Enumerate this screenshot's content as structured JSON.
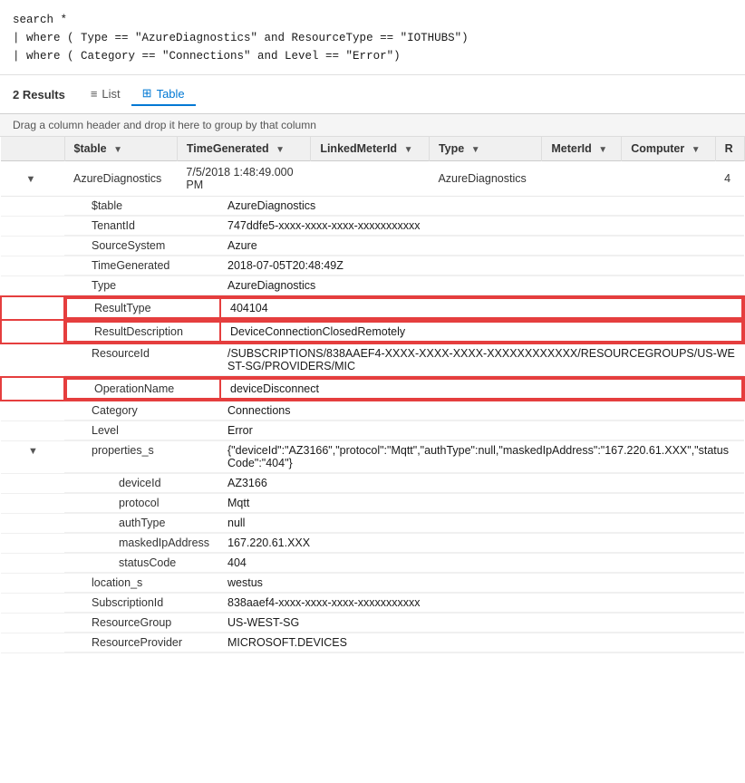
{
  "query": {
    "lines": [
      "search *",
      "| where ( Type == \"AzureDiagnostics\" and ResourceType == \"IOTHUBS\")",
      "| where ( Category == \"Connections\" and Level == \"Error\")"
    ]
  },
  "results": {
    "count": "2",
    "count_label": "Results",
    "tabs": [
      {
        "id": "list",
        "label": "List",
        "icon": "≡",
        "active": false
      },
      {
        "id": "table",
        "label": "Table",
        "icon": "⊞",
        "active": true
      }
    ],
    "drag_hint": "Drag a column header and drop it here to group by that column",
    "columns": [
      {
        "id": "stable",
        "label": "$table"
      },
      {
        "id": "timegenerated",
        "label": "TimeGenerated"
      },
      {
        "id": "linkedmeterid",
        "label": "LinkedMeterId"
      },
      {
        "id": "type",
        "label": "Type"
      },
      {
        "id": "meterid",
        "label": "MeterId"
      },
      {
        "id": "computer",
        "label": "Computer"
      },
      {
        "id": "r",
        "label": "R"
      }
    ],
    "rows": [
      {
        "id": "row1",
        "expand": true,
        "stable": "AzureDiagnostics",
        "timegenerated": "7/5/2018 1:48:49.000 PM",
        "linkedmeterid": "",
        "type": "AzureDiagnostics",
        "meterid": "",
        "computer": "",
        "r": "4",
        "details": [
          {
            "key": "$table",
            "value": "AzureDiagnostics",
            "highlighted": false,
            "sub_expand": false
          },
          {
            "key": "TenantId",
            "value": "747ddfe5-xxxx-xxxx-xxxx-xxxxxxxxxxx",
            "highlighted": false,
            "sub_expand": false
          },
          {
            "key": "SourceSystem",
            "value": "Azure",
            "highlighted": false,
            "sub_expand": false
          },
          {
            "key": "TimeGenerated",
            "value": "2018-07-05T20:48:49Z",
            "highlighted": false,
            "sub_expand": false
          },
          {
            "key": "Type",
            "value": "AzureDiagnostics",
            "highlighted": false,
            "sub_expand": false
          },
          {
            "key": "ResultType",
            "value": "404104",
            "highlighted": true,
            "sub_expand": false
          },
          {
            "key": "ResultDescription",
            "value": "DeviceConnectionClosedRemotely",
            "highlighted": true,
            "sub_expand": false
          },
          {
            "key": "ResourceId",
            "value": "/SUBSCRIPTIONS/838AAEF4-XXXX-XXXX-XXXX-XXXXXXXXXXXX/RESOURCEGROUPS/US-WEST-SG/PROVIDERS/MIC",
            "highlighted": false,
            "sub_expand": false
          },
          {
            "key": "OperationName",
            "value": "deviceDisconnect",
            "highlighted": true,
            "sub_expand": false
          },
          {
            "key": "Category",
            "value": "Connections",
            "highlighted": false,
            "sub_expand": false
          },
          {
            "key": "Level",
            "value": "Error",
            "highlighted": false,
            "sub_expand": false
          },
          {
            "key": "properties_s",
            "value": "{\"deviceId\":\"AZ3166\",\"protocol\":\"Mqtt\",\"authType\":null,\"maskedIpAddress\":\"167.220.61.XXX\",\"statusCode\":\"404\"}",
            "highlighted": false,
            "sub_expand": true,
            "sub_details": [
              {
                "key": "deviceId",
                "value": "AZ3166"
              },
              {
                "key": "protocol",
                "value": "Mqtt"
              },
              {
                "key": "authType",
                "value": "null"
              },
              {
                "key": "maskedIpAddress",
                "value": "167.220.61.XXX"
              },
              {
                "key": "statusCode",
                "value": "404"
              }
            ]
          },
          {
            "key": "location_s",
            "value": "westus",
            "highlighted": false,
            "sub_expand": false
          },
          {
            "key": "SubscriptionId",
            "value": "838aaef4-xxxx-xxxx-xxxx-xxxxxxxxxxx",
            "highlighted": false,
            "sub_expand": false
          },
          {
            "key": "ResourceGroup",
            "value": "US-WEST-SG",
            "highlighted": false,
            "sub_expand": false
          },
          {
            "key": "ResourceProvider",
            "value": "MICROSOFT.DEVICES",
            "highlighted": false,
            "sub_expand": false
          }
        ]
      }
    ]
  }
}
